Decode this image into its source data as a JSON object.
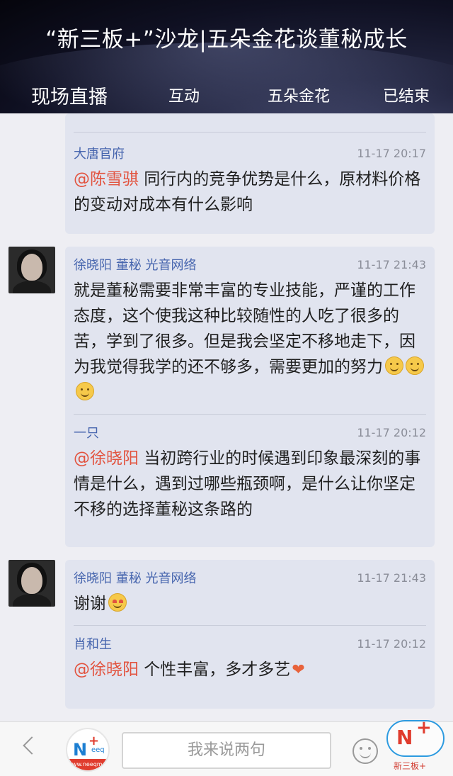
{
  "header": {
    "title": "“新三板+”沙龙|五朵金花谈董秘成长",
    "tabs": [
      {
        "label": "现场直播",
        "active": true
      },
      {
        "label": "互动",
        "active": false
      },
      {
        "label": "五朵金花",
        "active": false
      },
      {
        "label": "已结束",
        "active": false
      }
    ]
  },
  "messages": [
    {
      "quote_name": "大唐官府",
      "quote_time": "11-17 20:17",
      "quote_mention": "@陈雪骐",
      "quote_text": " 同行内的竞争优势是什么，原材料价格的变动对成本有什么影响"
    },
    {
      "name": "徐晓阳 董秘 光音网络",
      "time": "11-17 21:43",
      "text": "就是董秘需要非常丰富的专业技能，严谨的工作态度，这个使我这种比较随性的人吃了很多的苦，学到了很多。但是我会坚定不移地走下，因为我觉得我学的还不够多，需要更加的努力",
      "quote_name": "一只",
      "quote_time": "11-17 20:12",
      "quote_mention": "@徐晓阳",
      "quote_text": " 当初跨行业的时候遇到印象最深刻的事情是什么，遇到过哪些瓶颈啊，是什么让你坚定不移的选择董秘这条路的"
    },
    {
      "name": "徐晓阳 董秘 光音网络",
      "time": "11-17 21:43",
      "text": "谢谢",
      "quote_name": "肖和生",
      "quote_time": "11-17 20:12",
      "quote_mention": "@徐晓阳",
      "quote_text": " 个性丰富，多才多艺"
    }
  ],
  "bottom": {
    "input_placeholder": "我来说两句",
    "logo_n": "N",
    "logo_plus": "+",
    "logo_eeq": "eeq",
    "logo_foot": "www.neeqm.cn",
    "watermark_label": "新三板+"
  },
  "colors": {
    "link_blue": "#4665ae",
    "mention_red": "#e2533f",
    "bubble_bg": "#e1e4ef"
  }
}
